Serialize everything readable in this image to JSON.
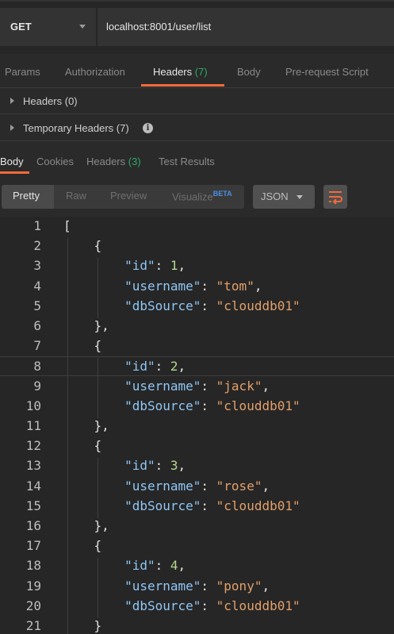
{
  "request": {
    "method": "GET",
    "url": "localhost:8001/user/list"
  },
  "request_tabs": [
    {
      "label": "Params"
    },
    {
      "label": "Authorization"
    },
    {
      "label": "Headers",
      "count": "(7)"
    },
    {
      "label": "Body"
    },
    {
      "label": "Pre-request Script"
    }
  ],
  "sections": {
    "headers": "Headers (0)",
    "temp_headers": "Temporary Headers (7)",
    "info_glyph": "i"
  },
  "response_tabs": [
    {
      "label": "Body"
    },
    {
      "label": "Cookies"
    },
    {
      "label": "Headers",
      "count": "(3)"
    },
    {
      "label": "Test Results"
    }
  ],
  "view_modes": {
    "pretty": "Pretty",
    "raw": "Raw",
    "preview": "Preview",
    "visualize": "Visualize",
    "beta": "BETA"
  },
  "format": "JSON",
  "users": [
    {
      "id": 1,
      "username": "tom",
      "dbSource": "clouddb01"
    },
    {
      "id": 2,
      "username": "jack",
      "dbSource": "clouddb01"
    },
    {
      "id": 3,
      "username": "rose",
      "dbSource": "clouddb01"
    },
    {
      "id": 4,
      "username": "pony",
      "dbSource": "clouddb01"
    }
  ],
  "current_line": 8,
  "visible_lines": 21,
  "colors": {
    "accent": "#f26b3a",
    "count": "#2fa86a",
    "json_key": "#8fc6f5",
    "json_string": "#e2a06a",
    "json_number": "#b6d78e"
  }
}
